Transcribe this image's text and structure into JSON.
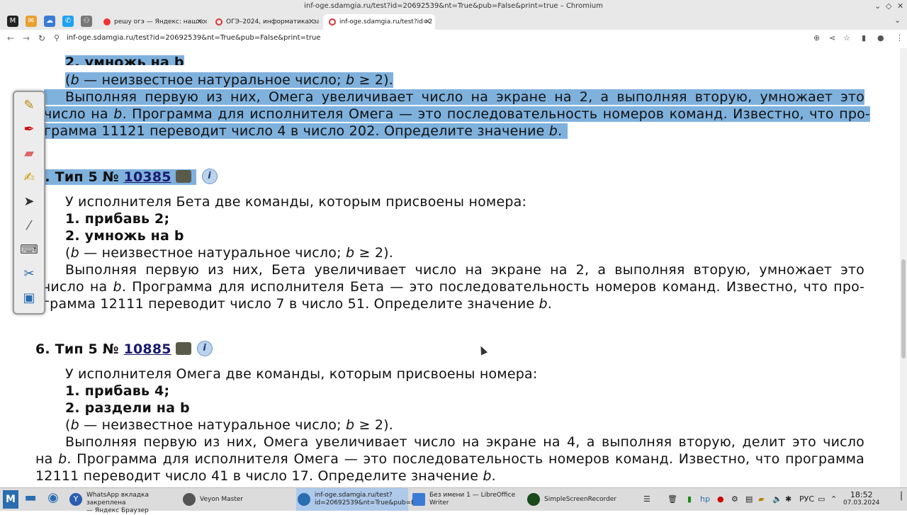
{
  "window": {
    "title": "inf-oge.sdamgia.ru/test?id=20692539&nt=True&pub=False&print=true – Chromium"
  },
  "tabs": [
    {
      "label": "решу огэ — Яндекс: нашлос",
      "active": false
    },
    {
      "label": "ОГЭ–2024, информатика: за",
      "active": false
    },
    {
      "label": "inf-oge.sdamgia.ru/test?id=2",
      "active": true
    }
  ],
  "address_bar": {
    "url": "inf-oge.sdamgia.ru/test?id=20692539&nt=True&pub=False&print=true"
  },
  "problem4_tail": {
    "cmd2": "2. умножь на b",
    "cond": [
      "(",
      "b",
      " — неизвестное натуральное число; ",
      "b",
      " ≥ 2)."
    ],
    "p1": "Выполняя первую из них, Омега увеличивает число на экране на 2, а выполняя вторую, умножает это",
    "p2a": "число на ",
    "p2b": "b",
    "p2c": ". Программа для исполнителя Омега — это последовательность номеров команд. Известно, что про-",
    "p3a": "грамма 11121 переводит число 4 в число 202. Определите значение ",
    "p3b": "b",
    "p3c": "."
  },
  "problem5": {
    "header_prefix": "5. Тип 5 № ",
    "number": "10385",
    "intro": "У исполнителя Бета две команды, которым присвоены номера:",
    "cmd1": "1. прибавь 2;",
    "cmd2": "2. умножь на b",
    "cond": [
      "(",
      "b",
      " — неизвестное натуральное число; ",
      "b",
      " ≥ 2)."
    ],
    "p1": "Выполняя первую из них, Бета увеличивает число на экране на 2, а выполняя вторую, умножает это",
    "p2a": "число на ",
    "p2b": "b",
    "p2c": ". Программа для исполнителя Бета — это последовательность номеров команд. Известно, что про-",
    "p3a": "грамма 12111 переводит число 7 в число 51. Определите значение ",
    "p3b": "b",
    "p3c": "."
  },
  "problem6": {
    "header_prefix": "6. Тип 5 № ",
    "number": "10885",
    "intro": "У исполнителя Омега две команды, которым присвоены номера:",
    "cmd1": "1. прибавь 4;",
    "cmd2": "2. раздели на b",
    "cond": [
      "(",
      "b",
      " — неизвестное натуральное число; ",
      "b",
      " ≥ 2)."
    ],
    "p1": "Выполняя первую из них, Омега увеличивает число на экране на 4, а выполняя вторую, делит это число",
    "p2a": "на ",
    "p2b": "b",
    "p2c": ". Программа для исполнителя Омега — это последовательность номеров команд. Известно, что программа",
    "p3a": "12111 переводит число 41 в число 17. Определите значение ",
    "p3b": "b",
    "p3c": "."
  },
  "info_icon": "i",
  "taskbar": {
    "items": [
      {
        "label": "WhatsApp вкладка закреплена",
        "label2": "— Яндекс Браузер"
      },
      {
        "label": "Veyon Master",
        "label2": ""
      },
      {
        "label": "inf-oge.sdamgia.ru/test?",
        "label2": "id=20692539&nt=True&pub=Fa..."
      },
      {
        "label": "Без имени 1 — LibreOffice",
        "label2": "Writer"
      },
      {
        "label": "SimpleScreenRecorder",
        "label2": ""
      }
    ],
    "language": "РУС",
    "time": "18:52",
    "date": "07.03.2024"
  },
  "colors": {
    "selection": "#7fb1dd",
    "link": "#1a1a6e",
    "accent": "#1a73e8"
  }
}
